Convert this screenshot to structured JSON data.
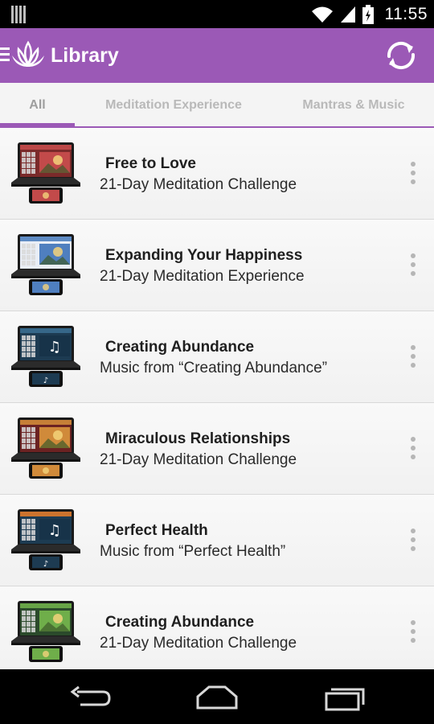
{
  "status_bar": {
    "time": "11:55"
  },
  "app_bar": {
    "title": "Library"
  },
  "tabs": [
    {
      "label": "All",
      "active": true
    },
    {
      "label": "Meditation Experience",
      "active": false
    },
    {
      "label": "Mantras & Music",
      "active": false
    }
  ],
  "items": [
    {
      "title": "Free to Love",
      "subtitle": "21-Day Meditation Challenge",
      "thumb_label": "Free to Love",
      "thumb_bg": "#7a2a2a",
      "thumb_accent": "#c24a4a",
      "thumb_kind": "photo"
    },
    {
      "title": "Expanding Your Happiness",
      "subtitle": "21-Day Meditation Experience",
      "thumb_label": "Expanding Your Happiness",
      "thumb_bg": "#e9eef6",
      "thumb_accent": "#4f7fbf",
      "thumb_kind": "photo"
    },
    {
      "title": "Creating Abundance",
      "subtitle": "Music from “Creating Abundance”",
      "thumb_label": "Mantras & Music",
      "thumb_bg": "#1d3b52",
      "thumb_accent": "#3a6d8f",
      "thumb_kind": "music"
    },
    {
      "title": "Miraculous Relationships",
      "subtitle": "21-Day Meditation Challenge",
      "thumb_label": "Miraculous Relationships",
      "thumb_bg": "#6b2222",
      "thumb_accent": "#d08a3a",
      "thumb_kind": "photo"
    },
    {
      "title": "Perfect Health",
      "subtitle": "Music from “Perfect Health”",
      "thumb_label": "Mantras & Music",
      "thumb_bg": "#1d3b52",
      "thumb_accent": "#e07a2a",
      "thumb_kind": "music"
    },
    {
      "title": "Creating Abundance",
      "subtitle": "21-Day Meditation Challenge",
      "thumb_label": "Creating Abundance",
      "thumb_bg": "#2b4a2b",
      "thumb_accent": "#6fae4a",
      "thumb_kind": "photo"
    }
  ],
  "colors": {
    "accent": "#9b59b6",
    "tab_inactive": "#b9b9b9"
  },
  "icons": {
    "menu": "menu-icon",
    "logo": "lotus-icon",
    "refresh": "refresh-icon",
    "more": "more-vert-icon",
    "back": "back-icon",
    "home": "home-icon",
    "recents": "recents-icon"
  }
}
